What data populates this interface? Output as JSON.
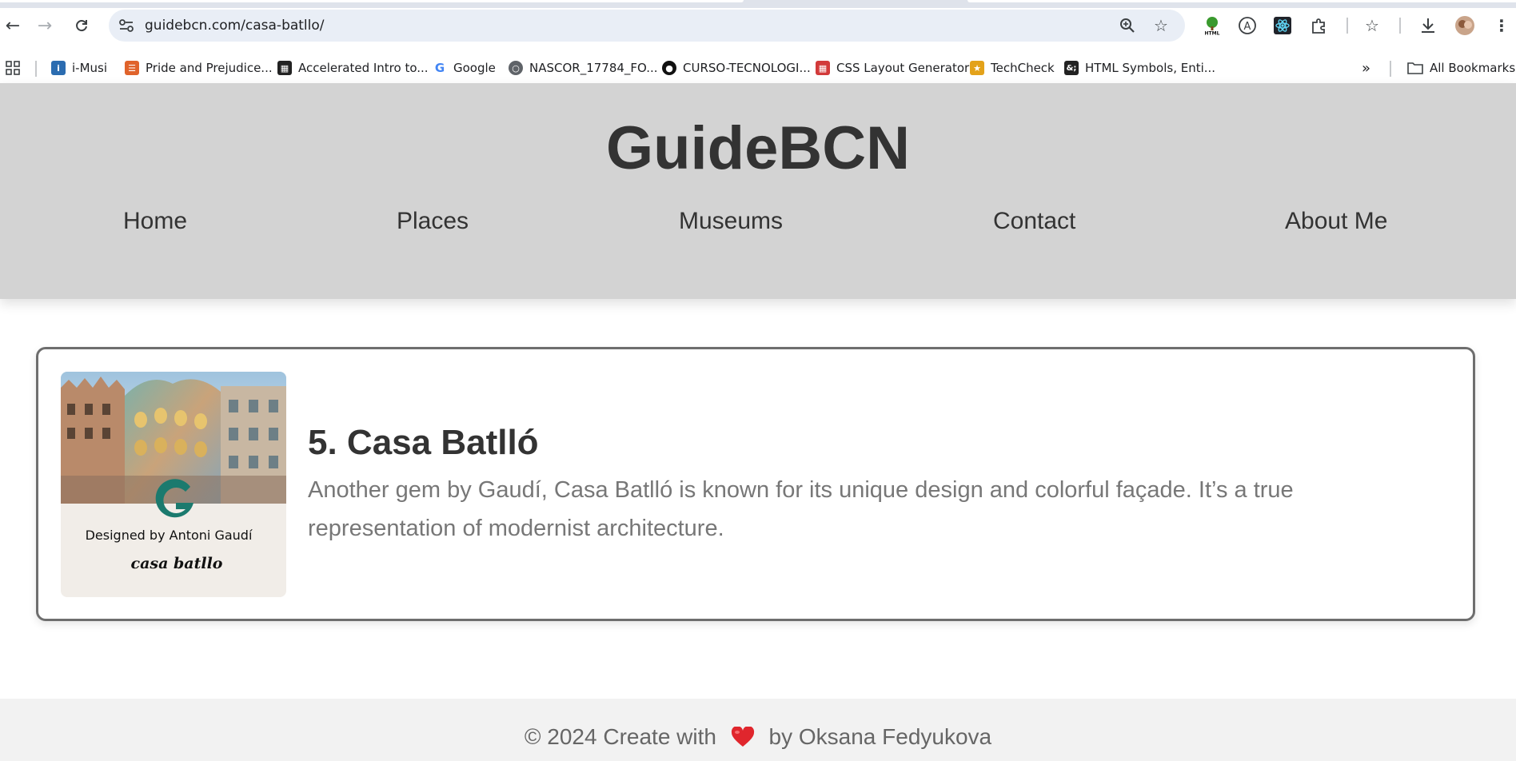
{
  "browser": {
    "url": "guidebcn.com/casa-batllo/",
    "bookmarks": [
      {
        "label": "i-Musi",
        "icon": "imusi-icon",
        "color": "#2b6cb0"
      },
      {
        "label": "Pride and Prejudice...",
        "icon": "book-stack-icon",
        "color": "#e0632b"
      },
      {
        "label": "Accelerated Intro to...",
        "icon": "grid-logo-icon",
        "color": "#222222"
      },
      {
        "label": "Google",
        "icon": "google-icon",
        "color": "#4285f4"
      },
      {
        "label": "NASCOR_17784_FO...",
        "icon": "globe-icon",
        "color": "#5f6368"
      },
      {
        "label": "CURSO-TECNOLOGI...",
        "icon": "github-icon",
        "color": "#111111"
      },
      {
        "label": "CSS Layout Generator",
        "icon": "css-grid-icon",
        "color": "#d23a3a"
      },
      {
        "label": "TechCheck",
        "icon": "peacock-icon",
        "color": "#e3a21a"
      },
      {
        "label": "HTML Symbols, Enti...",
        "icon": "html-entities-icon",
        "color": "#222222"
      }
    ],
    "all_bookmarks_label": "All Bookmarks"
  },
  "site": {
    "title": "GuideBCN",
    "nav": [
      "Home",
      "Places",
      "Museums",
      "Contact",
      "About Me"
    ],
    "colors": {
      "header_bg": "#d3d3d3",
      "text": "#333333",
      "muted": "#777777",
      "footer_bg": "#f2f2f2"
    }
  },
  "card": {
    "image": {
      "caption_line1": "Designed by Antoni Gaudí",
      "caption_line2": "casa batllo"
    },
    "title": "5. Casa Batlló",
    "text": "Another gem by Gaudí, Casa Batlló is known for its unique design and colorful façade. It’s a true representation of modernist architecture."
  },
  "footer": {
    "prefix": "© 2024 Create with",
    "suffix": "by Oksana Fedyukova"
  }
}
